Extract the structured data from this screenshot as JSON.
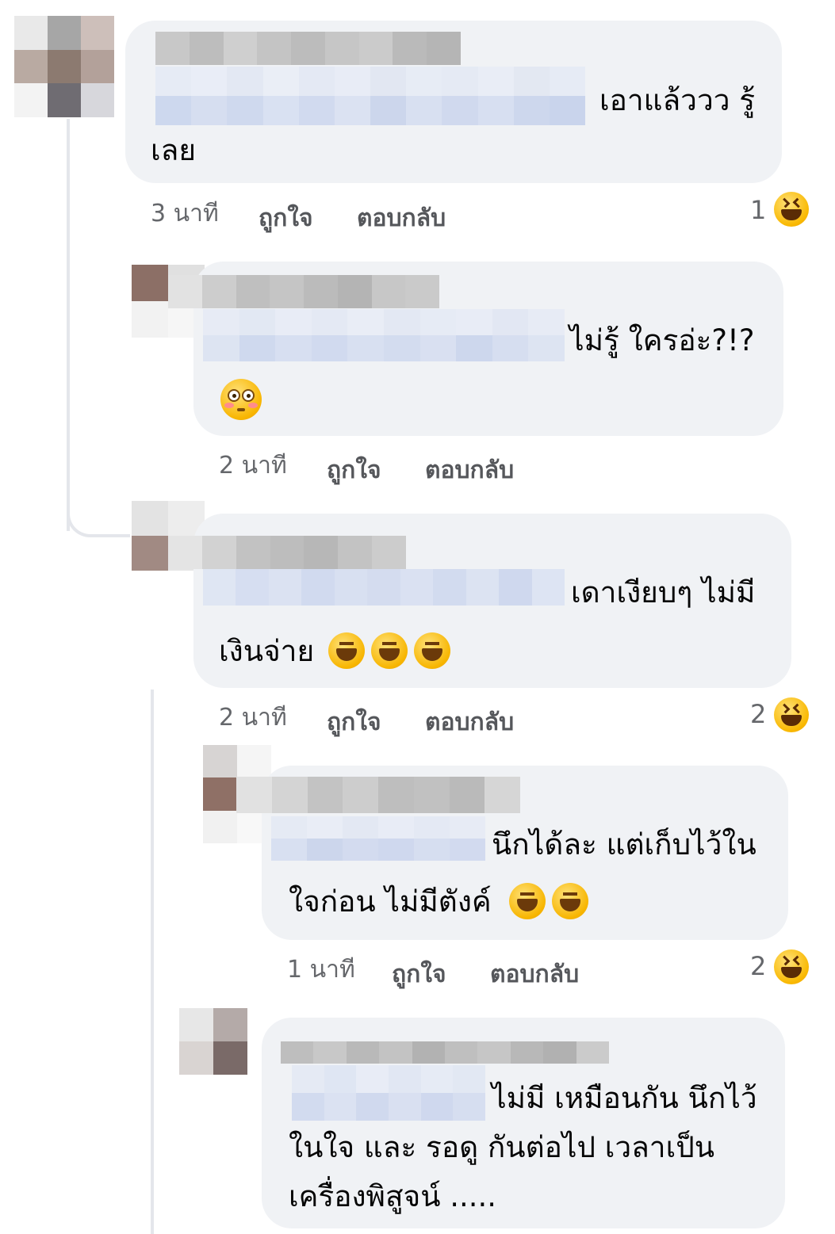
{
  "comments": [
    {
      "text_lines": [
        "เอาแล้ววว รู้",
        "เลย"
      ],
      "time": "3 นาที",
      "like_label": "ถูกใจ",
      "reply_label": "ตอบกลับ",
      "reaction_count": "1",
      "reaction_icon": "laughing-reaction-icon"
    },
    {
      "text_lines": [
        "ไม่รู้ ใครอ่ะ?!?"
      ],
      "emojis": [
        "flushed-face-emoji"
      ],
      "time": "2 นาที",
      "like_label": "ถูกใจ",
      "reply_label": "ตอบกลับ"
    },
    {
      "text_lines": [
        "เดาเงียบๆ ไม่มี",
        "เงินจ่าย"
      ],
      "emojis": [
        "face-with-tears-of-joy",
        "face-with-tears-of-joy",
        "face-with-tears-of-joy"
      ],
      "time": "2 นาที",
      "like_label": "ถูกใจ",
      "reply_label": "ตอบกลับ",
      "reaction_count": "2",
      "reaction_icon": "laughing-reaction-icon"
    },
    {
      "text_lines": [
        "นึกได้ละ แต่เก็บไว้ใน",
        "ใจก่อน ไม่มีตังค์"
      ],
      "emojis": [
        "face-with-tears-of-joy",
        "face-with-tears-of-joy"
      ],
      "time": "1 นาที",
      "like_label": "ถูกใจ",
      "reply_label": "ตอบกลับ",
      "reaction_count": "2",
      "reaction_icon": "laughing-reaction-icon"
    },
    {
      "text_lines": [
        "ไม่มี เหมือนกัน นึกไว้",
        "ในใจ และ รอดู กันต่อไป เวลาเป็น",
        "เครื่องพิสูจน์ ....."
      ]
    }
  ],
  "colors": {
    "bubble": "#f0f2f5",
    "meta_text": "#65676b",
    "thread_line": "#e4e6eb"
  }
}
